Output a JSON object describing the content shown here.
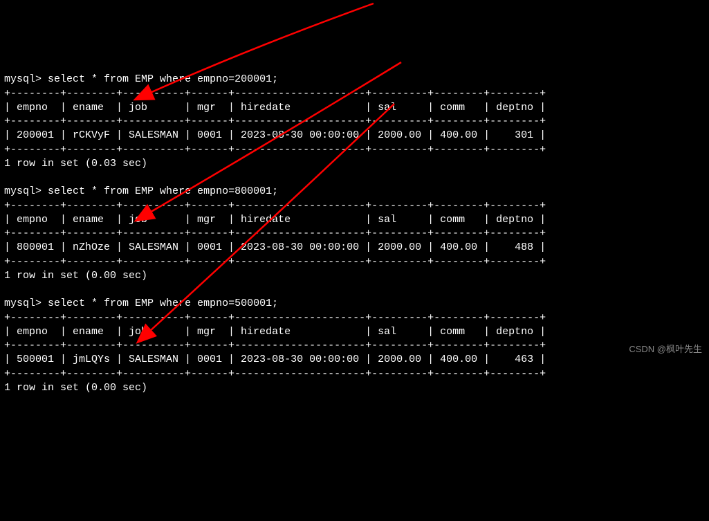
{
  "queries": [
    {
      "prompt": "mysql>",
      "sql": "select * from EMP where empno=200001;",
      "border": "+--------+--------+----------+------+---------------------+---------+--------+--------+",
      "header": "| empno  | ename  | job      | mgr  | hiredate            | sal     | comm   | deptno |",
      "row": "| 200001 | rCKVyF | SALESMAN | 0001 | 2023-08-30 00:00:00 | 2000.00 | 400.00 |    301 |",
      "result": "1 row in set (0.03 sec)"
    },
    {
      "prompt": "mysql>",
      "sql": "select * from EMP where empno=800001;",
      "border": "+--------+--------+----------+------+---------------------+---------+--------+--------+",
      "header": "| empno  | ename  | job      | mgr  | hiredate            | sal     | comm   | deptno |",
      "row": "| 800001 | nZhOze | SALESMAN | 0001 | 2023-08-30 00:00:00 | 2000.00 | 400.00 |    488 |",
      "result": "1 row in set (0.00 sec)"
    },
    {
      "prompt": "mysql>",
      "sql": "select * from EMP where empno=500001;",
      "border": "+--------+--------+----------+------+---------------------+---------+--------+--------+",
      "header": "| empno  | ename  | job      | mgr  | hiredate            | sal     | comm   | deptno |",
      "row": "| 500001 | jmLQYs | SALESMAN | 0001 | 2023-08-30 00:00:00 | 2000.00 | 400.00 |    463 |",
      "result": "1 row in set (0.00 sec)"
    }
  ],
  "watermark": "CSDN @枫叶先生"
}
